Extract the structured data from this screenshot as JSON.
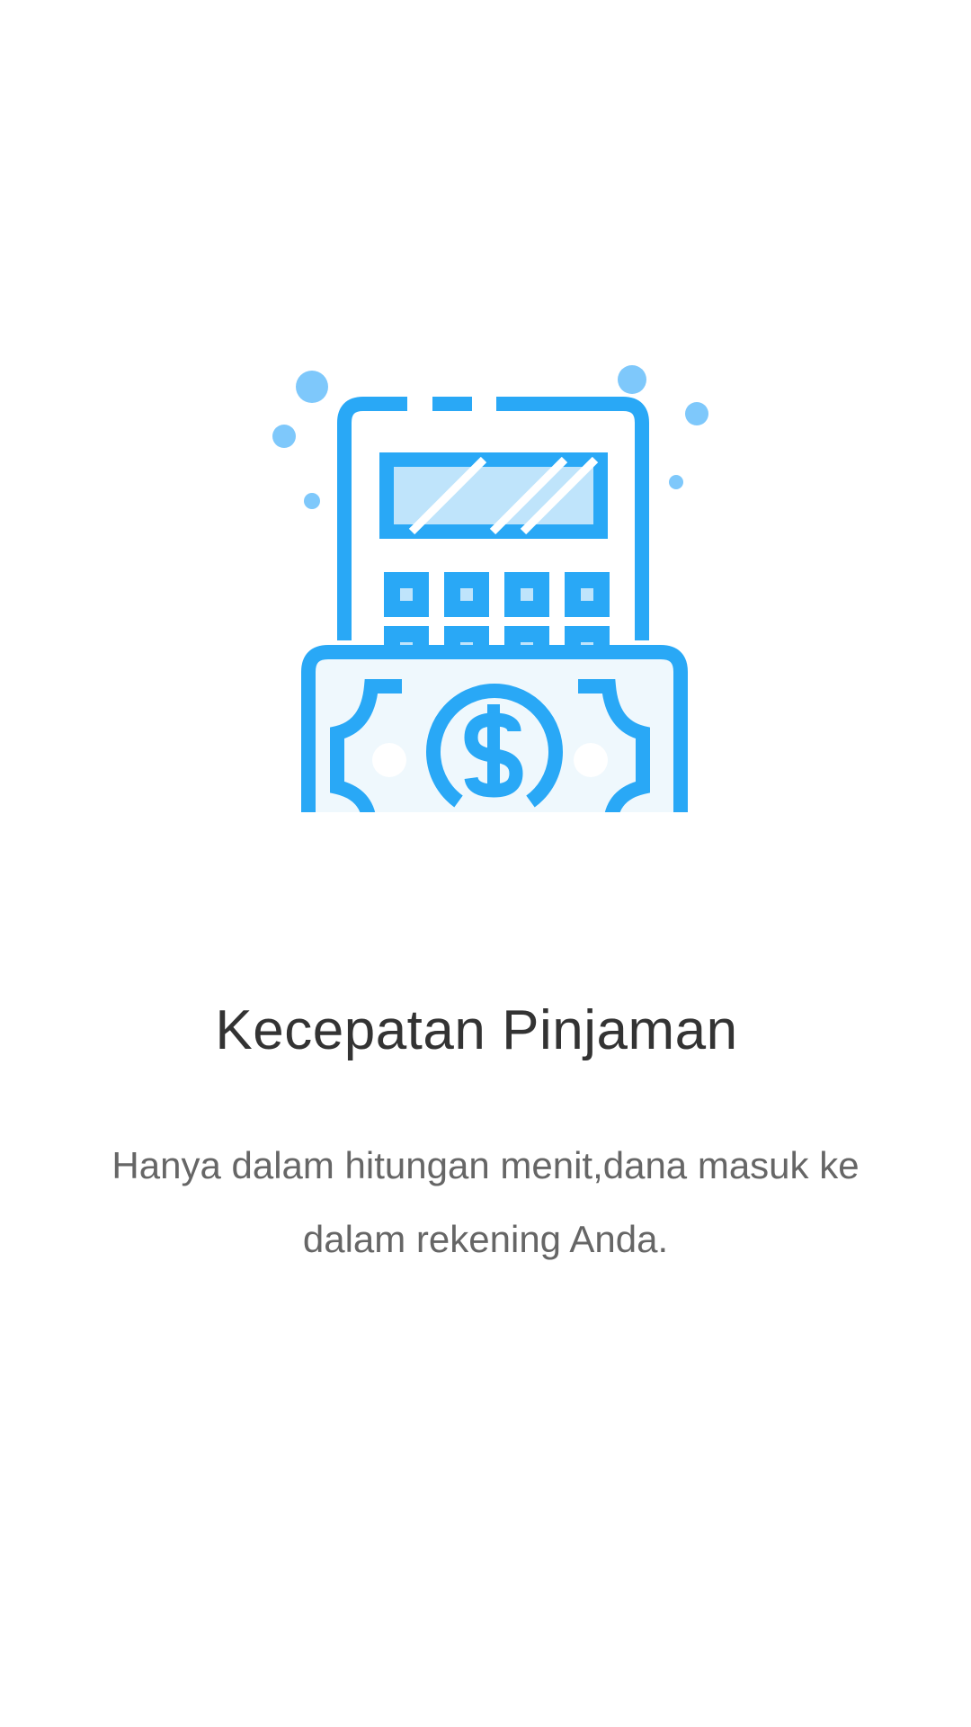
{
  "onboarding": {
    "illustration_icon": "calculator-money-icon",
    "title": "Kecepatan Pinjaman",
    "description": "Hanya dalam hitungan menit,dana masuk ke dalam rekening Anda."
  },
  "colors": {
    "accent": "#29a8f6",
    "accent_light": "#7ec8fb",
    "screen_fill": "#bfe4fb",
    "bill_fill": "#eff8fd",
    "title_text": "#333333",
    "body_text": "#666666",
    "background": "#ffffff"
  }
}
